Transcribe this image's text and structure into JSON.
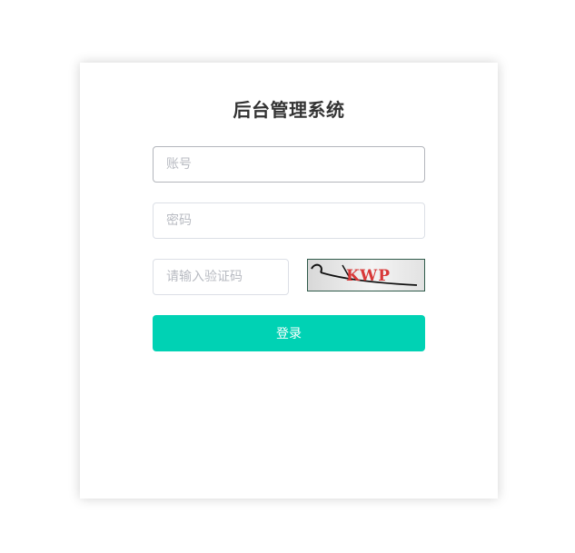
{
  "page": {
    "title": "后台管理系统"
  },
  "form": {
    "account": {
      "value": "",
      "placeholder": "账号"
    },
    "password": {
      "value": "",
      "placeholder": "密码"
    },
    "captcha": {
      "value": "",
      "placeholder": "请输入验证码"
    },
    "captcha_image_text": "KWP",
    "submit_label": "登录"
  },
  "colors": {
    "primary": "#00d2b4",
    "title": "#333333",
    "border": "#dcdfe6",
    "placeholder": "#b8bbc2",
    "captcha_text": "#d83838"
  }
}
